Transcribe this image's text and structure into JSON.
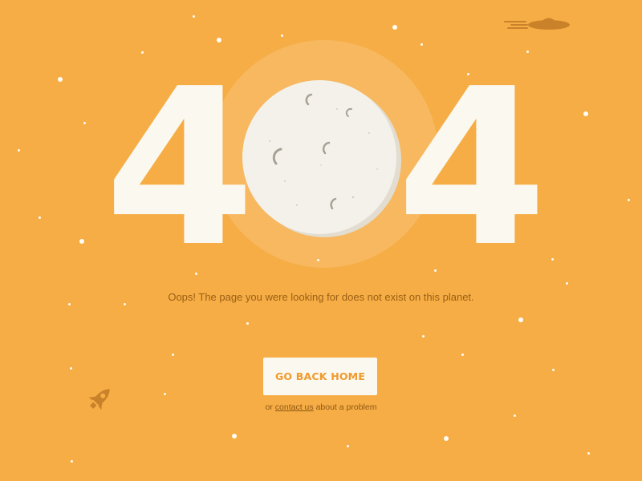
{
  "error_page": {
    "digit_left": "4",
    "digit_right": "4",
    "moon_icon": "moon-icon",
    "message": "Oops! The page you were looking for does not exist on this planet.",
    "home_button_label": "GO BACK HOME",
    "footer_prefix": "or",
    "contact_link_label": "contact us",
    "footer_suffix": "about a problem"
  },
  "decorations": {
    "ufo_icon": "ufo-icon",
    "rocket_icon": "rocket-icon",
    "star_icon": "star-icon"
  },
  "colors": {
    "background": "#f6ad45",
    "digit": "#fbf8ef",
    "moon": "#f3f1ea",
    "text": "#9a5f14",
    "button_text": "#f19a2c",
    "icon": "#c9822a"
  }
}
